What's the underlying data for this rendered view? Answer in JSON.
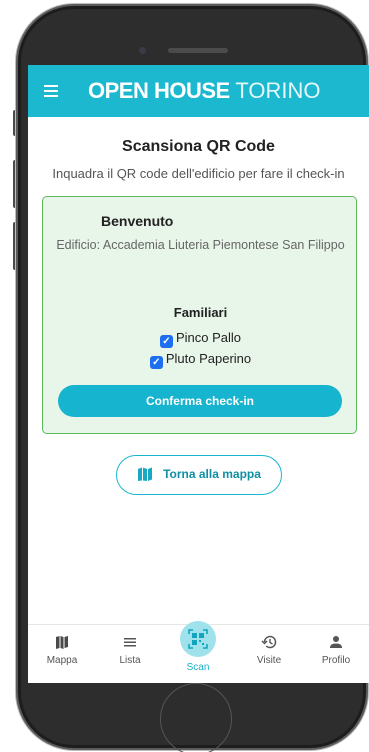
{
  "header": {
    "logo_bold": "OPEN HOUSE",
    "logo_light": "TORINO",
    "accent": "#1cb8cf"
  },
  "scan": {
    "title": "Scansiona QR Code",
    "subtitle": "Inquadra il QR code dell'edificio per fare il check-in"
  },
  "card": {
    "welcome": "Benvenuto",
    "building": "Edificio: Accademia Liuteria Piemontese San Filippo",
    "family_label": "Familiari",
    "members": [
      {
        "name": "Pinco Pallo",
        "checked": true
      },
      {
        "name": "Pluto Paperino",
        "checked": true
      }
    ],
    "confirm_label": "Conferma check-in"
  },
  "map_button": {
    "label": "Torna alla mappa",
    "icon": "map-icon"
  },
  "nav": {
    "items": [
      {
        "label": "Mappa",
        "icon": "map-icon"
      },
      {
        "label": "Lista",
        "icon": "list-icon"
      },
      {
        "label": "Scan",
        "icon": "qr-code-icon",
        "active": true
      },
      {
        "label": "Visite",
        "icon": "history-icon"
      },
      {
        "label": "Profilo",
        "icon": "person-icon"
      }
    ]
  }
}
